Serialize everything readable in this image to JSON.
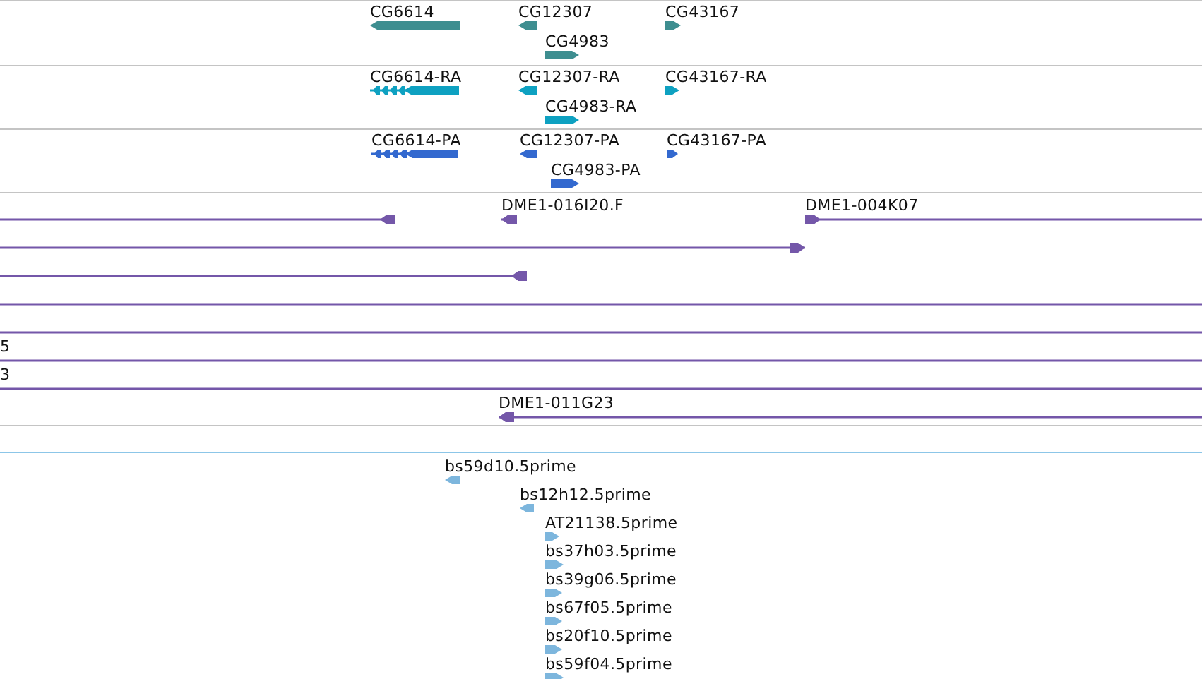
{
  "tracks": [
    {
      "kind": "gene",
      "features": [
        {
          "label": "CG6614",
          "kind": "left"
        },
        {
          "label": "CG12307",
          "kind": "left"
        },
        {
          "label": "CG43167",
          "kind": "right"
        },
        {
          "label": "CG4983",
          "kind": "right"
        }
      ]
    },
    {
      "kind": "transcript",
      "features": [
        {
          "label": "CG6614-RA",
          "kind": "left"
        },
        {
          "label": "CG12307-RA",
          "kind": "left"
        },
        {
          "label": "CG43167-RA",
          "kind": "right"
        },
        {
          "label": "CG4983-RA",
          "kind": "right"
        }
      ]
    },
    {
      "kind": "protein",
      "features": [
        {
          "label": "CG6614-PA",
          "kind": "left"
        },
        {
          "label": "CG12307-PA",
          "kind": "left"
        },
        {
          "label": "CG43167-PA",
          "kind": "right"
        },
        {
          "label": "CG4983-PA",
          "kind": "right"
        }
      ]
    },
    {
      "kind": "clone",
      "features": [
        {
          "kind": "left"
        },
        {
          "label": "DME1-016I20.F",
          "kind": "left"
        },
        {
          "label": "DME1-004K07",
          "kind": "right"
        },
        {
          "kind": "right"
        },
        {
          "kind": "left"
        },
        {
          "kind": "plain"
        },
        {
          "kind": "plain"
        },
        {
          "label": "5",
          "kind": "plain"
        },
        {
          "label": "3",
          "kind": "plain"
        },
        {
          "label": "DME1-011G23",
          "kind": "left"
        }
      ]
    },
    {
      "kind": "est",
      "features": [
        {
          "label": "bs59d10.5prime",
          "kind": "left"
        },
        {
          "label": "bs12h12.5prime",
          "kind": "left"
        },
        {
          "label": "AT21138.5prime",
          "kind": "right"
        },
        {
          "label": "bs37h03.5prime",
          "kind": "right"
        },
        {
          "label": "bs39g06.5prime",
          "kind": "right"
        },
        {
          "label": "bs67f05.5prime",
          "kind": "right"
        },
        {
          "label": "bs20f10.5prime",
          "kind": "right"
        },
        {
          "label": "bs59f04.5prime",
          "kind": "right"
        }
      ]
    }
  ]
}
